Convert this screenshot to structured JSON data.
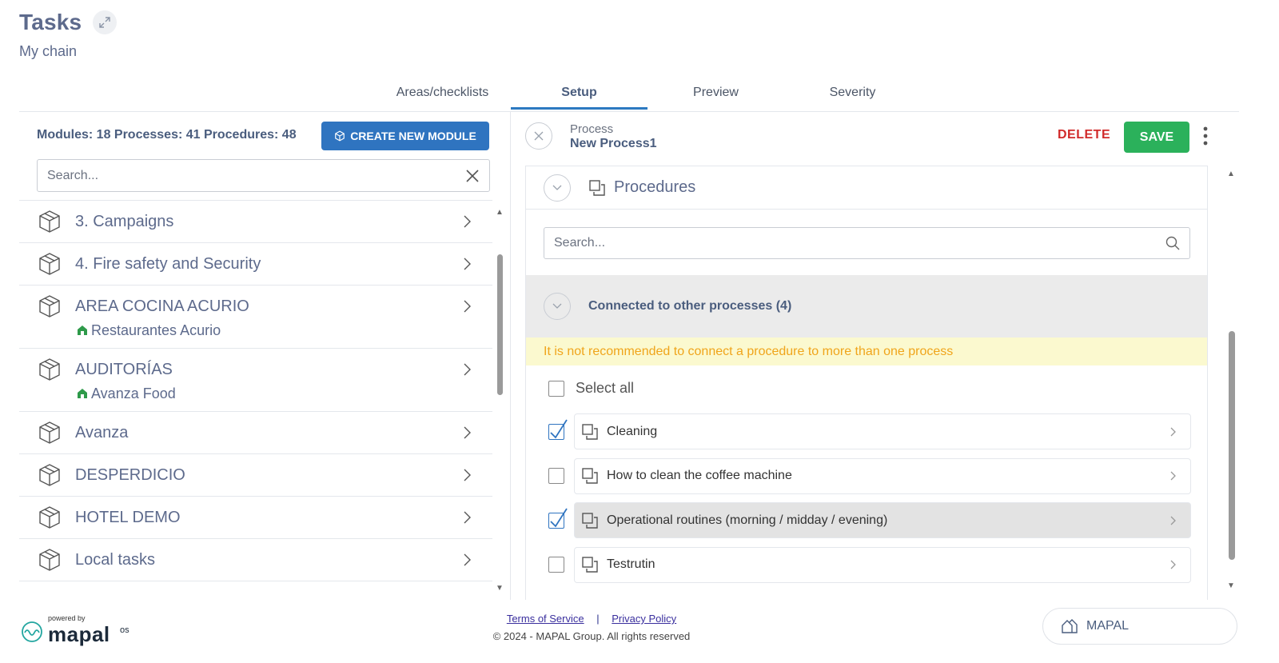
{
  "header": {
    "title": "Tasks",
    "subtitle": "My chain",
    "expand_icon": "expand-icon"
  },
  "tabs": [
    {
      "label": "Areas/checklists",
      "active": false
    },
    {
      "label": "Setup",
      "active": true
    },
    {
      "label": "Preview",
      "active": false
    },
    {
      "label": "Severity",
      "active": false
    }
  ],
  "left": {
    "counts": "Modules: 18 Processes: 41 Procedures: 48",
    "create_label": "CREATE NEW MODULE",
    "search_placeholder": "Search...",
    "modules": [
      {
        "name": "3. Campaigns",
        "sub": ""
      },
      {
        "name": "4. Fire safety and Security",
        "sub": ""
      },
      {
        "name": "AREA COCINA ACURIO",
        "sub": "Restaurantes Acurio"
      },
      {
        "name": "AUDITORÍAS",
        "sub": "Avanza Food"
      },
      {
        "name": "Avanza",
        "sub": ""
      },
      {
        "name": "DESPERDICIO",
        "sub": ""
      },
      {
        "name": "HOTEL DEMO",
        "sub": ""
      },
      {
        "name": "Local tasks",
        "sub": ""
      }
    ]
  },
  "right": {
    "process_label": "Process",
    "process_name": "New Process1",
    "delete_label": "DELETE",
    "save_label": "SAVE",
    "procedures_title": "Procedures",
    "search_placeholder": "Search...",
    "connected_label": "Connected to other processes (4)",
    "warning": "It is not recommended to connect a procedure to more than one process",
    "select_all": "Select all",
    "items": [
      {
        "name": "Cleaning",
        "checked": true
      },
      {
        "name": "How to clean the coffee machine",
        "checked": false
      },
      {
        "name": "Operational routines (morning / midday / evening)",
        "checked": true
      },
      {
        "name": "Testrutin",
        "checked": false
      }
    ]
  },
  "footer": {
    "powered_by": "powered by",
    "brand": "mapal",
    "brand_suffix": "os",
    "terms": "Terms of Service",
    "separator": "|",
    "privacy": "Privacy Policy",
    "copyright": "© 2024 - MAPAL Group. All rights reserved",
    "switch_label": "MAPAL"
  },
  "colors": {
    "primary": "#2f74c0",
    "save": "#2bb15b",
    "delete": "#d12b2b",
    "warning_text": "#f0a51b",
    "warning_bg": "#fbf9cf"
  }
}
